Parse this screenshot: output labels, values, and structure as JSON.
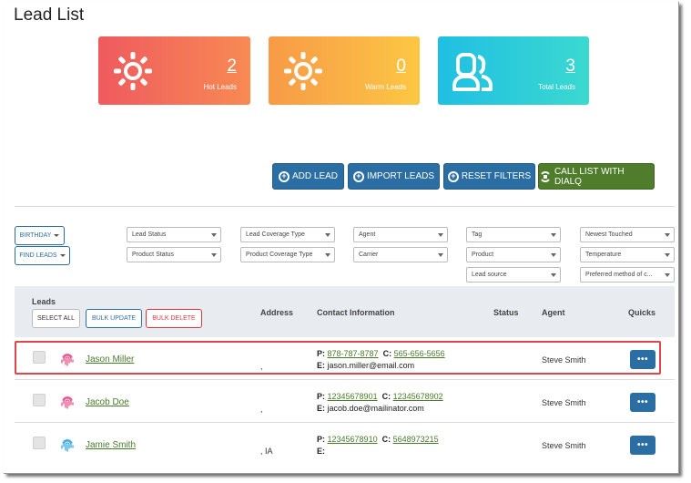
{
  "page": {
    "title": "Lead List"
  },
  "stats": [
    {
      "value": "2",
      "label": "Hot Leads",
      "icon": "sun-icon"
    },
    {
      "value": "0",
      "label": "Warm Leads",
      "icon": "sun-icon"
    },
    {
      "value": "3",
      "label": "Total Leads",
      "icon": "users-icon"
    }
  ],
  "actions": {
    "add_lead": "ADD LEAD",
    "import_leads": "IMPORT LEADS",
    "reset_filters": "RESET FILTERS",
    "call_list": "CALL LIST WITH DIALQ"
  },
  "filters": {
    "birthday": "BIRTHDAY",
    "find_leads": "FIND LEADS",
    "lead_status": "Lead Status",
    "product_status": "Product Status",
    "lead_coverage_type": "Lead Coverage Type",
    "product_coverage_type": "Product Coverage Type",
    "agent": "Agent",
    "carrier": "Carrier",
    "tag": "Tag",
    "product": "Product",
    "lead_source": "Lead source",
    "sort": "Newest Touched",
    "temperature": "Temperature",
    "preferred_method": "Preferred method of c..."
  },
  "table": {
    "headers": {
      "leads": "Leads",
      "address": "Address",
      "contact": "Contact Information",
      "status": "Status",
      "agent": "Agent",
      "quicks": "Quicks"
    },
    "select_all": "SELECT ALL",
    "bulk_update": "BULK UPDATE",
    "bulk_delete": "BULK DELETE",
    "rows": [
      {
        "name": "Jason Miller",
        "address": ",",
        "phone_label": "P:",
        "phone": "878-787-8787",
        "cell_label": "C:",
        "cell": "565-656-5656",
        "email_label": "E:",
        "email": "jason.miller@email.com",
        "agent": "Steve Smith",
        "quick": "•••",
        "temp_color": "#e8528a"
      },
      {
        "name": "Jacob Doe",
        "address": ",",
        "phone_label": "P:",
        "phone": "12345678901",
        "cell_label": "C:",
        "cell": "12345678902",
        "email_label": "E:",
        "email": "jacob.doe@mailinator.com",
        "agent": "Steve Smith",
        "quick": "•••",
        "temp_color": "#e8528a"
      },
      {
        "name": "Jamie Smith",
        "address": ", IA",
        "phone_label": "P:",
        "phone": "12345678910",
        "cell_label": "C:",
        "cell": "5648973215",
        "email_label": "E:",
        "email": "",
        "agent": "Steve Smith",
        "quick": "•••",
        "temp_color": "#3aa9e0"
      }
    ]
  }
}
